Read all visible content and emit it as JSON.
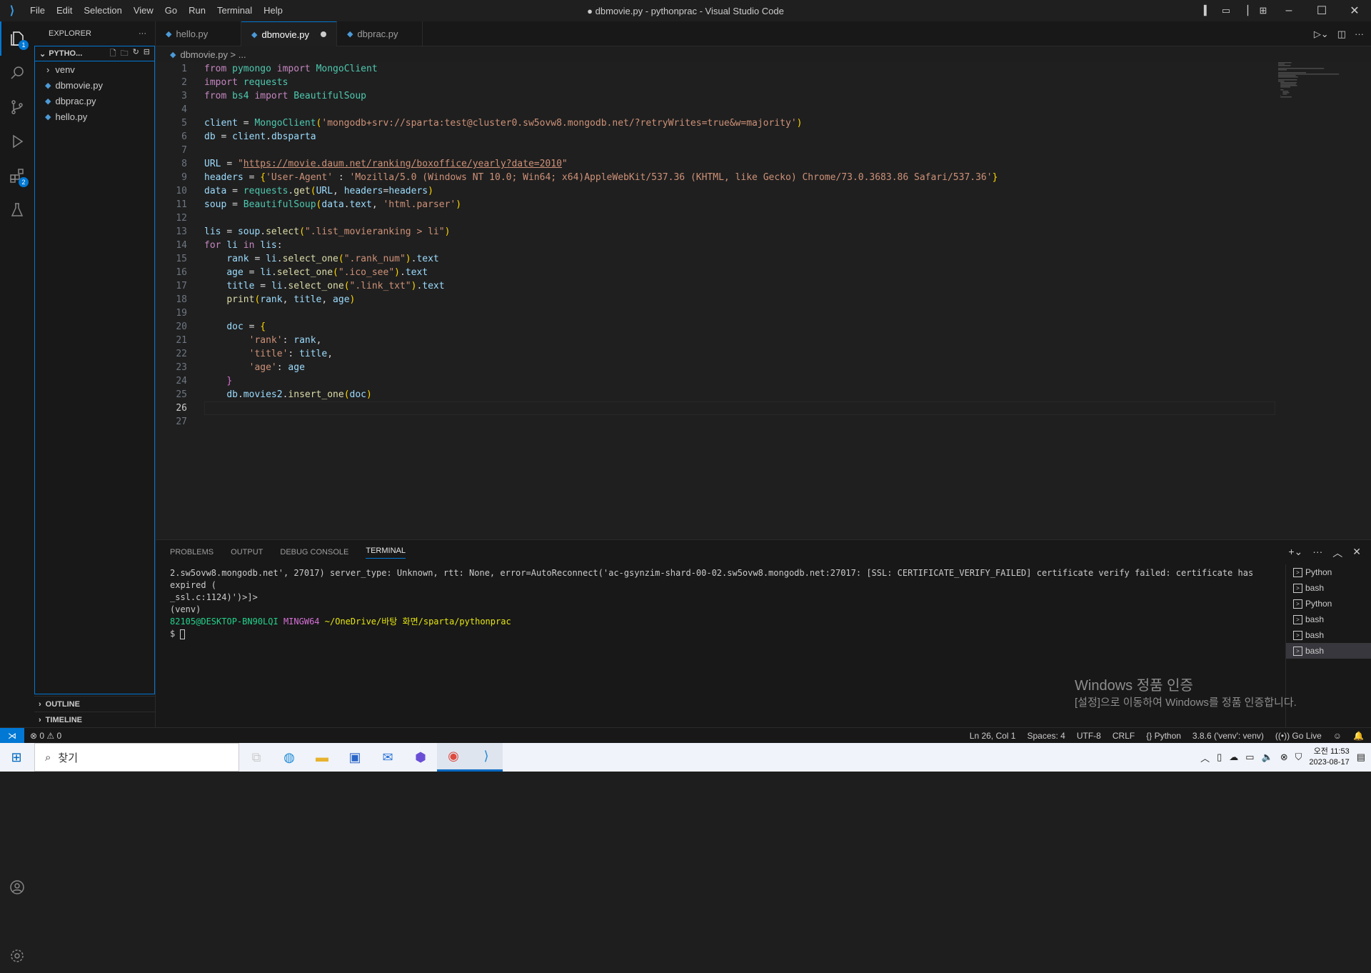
{
  "menu": [
    "File",
    "Edit",
    "Selection",
    "View",
    "Go",
    "Run",
    "Terminal",
    "Help"
  ],
  "window_title": "● dbmovie.py - pythonprac - Visual Studio Code",
  "explorer": {
    "title": "EXPLORER",
    "section": "PYTHO...",
    "items": [
      "venv",
      "dbmovie.py",
      "dbprac.py",
      "hello.py"
    ],
    "outline": "OUTLINE",
    "timeline": "TIMELINE"
  },
  "activity": {
    "explorer_badge": "1",
    "extensions_badge": "2"
  },
  "tabs": [
    "hello.py",
    "dbmovie.py",
    "dbprac.py"
  ],
  "breadcrumb": "dbmovie.py > ...",
  "code_lines": [
    "from pymongo import MongoClient",
    "import requests",
    "from bs4 import BeautifulSoup",
    "",
    "client = MongoClient('mongodb+srv://sparta:test@cluster0.sw5ovw8.mongodb.net/?retryWrites=true&w=majority')",
    "db = client.dbsparta",
    "",
    "URL = \"https://movie.daum.net/ranking/boxoffice/yearly?date=2010\"",
    "headers = {'User-Agent' : 'Mozilla/5.0 (Windows NT 10.0; Win64; x64)AppleWebKit/537.36 (KHTML, like Gecko) Chrome/73.0.3683.86 Safari/537.36'}",
    "data = requests.get(URL, headers=headers)",
    "soup = BeautifulSoup(data.text, 'html.parser')",
    "",
    "lis = soup.select(\".list_movieranking > li\")",
    "for li in lis:",
    "    rank = li.select_one(\".rank_num\").text",
    "    age = li.select_one(\".ico_see\").text",
    "    title = li.select_one(\".link_txt\").text",
    "    print(rank, title, age)",
    "",
    "    doc = {",
    "        'rank': rank,",
    "        'title': title,",
    "        'age': age",
    "    }",
    "    db.movies2.insert_one(doc)",
    "",
    ""
  ],
  "current_line": 26,
  "panel": {
    "tabs": [
      "PROBLEMS",
      "OUTPUT",
      "DEBUG CONSOLE",
      "TERMINAL"
    ],
    "terminal": {
      "line1": "2.sw5ovw8.mongodb.net', 27017) server_type: Unknown, rtt: None, error=AutoReconnect('ac-gsynzim-shard-00-02.sw5ovw8.mongodb.net:27017: [SSL: CERTIFICATE_VERIFY_FAILED] certificate verify failed: certificate has expired (",
      "line2": "_ssl.c:1124)')>]>",
      "line3": "(venv)",
      "user": "82105@DESKTOP-BN90LQI",
      "shell": "MINGW64",
      "path": "~/OneDrive/바탕 화면/sparta/pythonprac",
      "prompt": "$"
    },
    "terminal_list": [
      "Python",
      "bash",
      "Python",
      "bash",
      "bash",
      "bash"
    ]
  },
  "watermark": {
    "title": "Windows 정품 인증",
    "sub": "[설정]으로 이동하여 Windows를 정품 인증합니다."
  },
  "status": {
    "problems": "⊗ 0 ⚠ 0",
    "pos": "Ln 26, Col 1",
    "spaces": "Spaces: 4",
    "enc": "UTF-8",
    "eol": "CRLF",
    "lang": "Python",
    "interp": "3.8.6 ('venv': venv)",
    "golive": "Go Live"
  },
  "taskbar": {
    "search": "찾기",
    "time": "오전 11:53",
    "date": "2023-08-17"
  }
}
